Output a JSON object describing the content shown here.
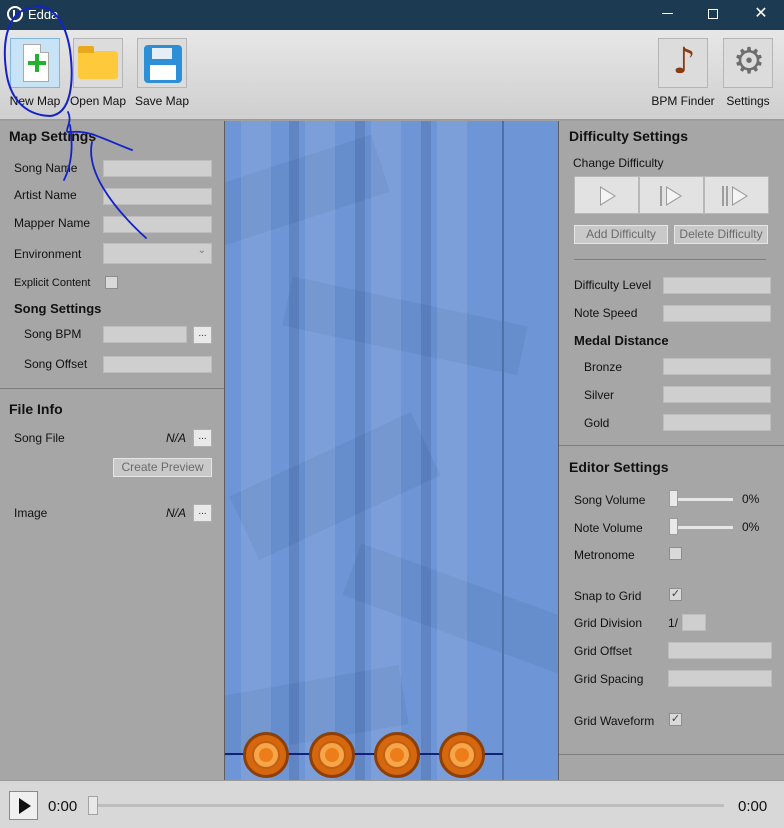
{
  "window": {
    "title": "Edda",
    "minimize_label": "—",
    "maximize_label": "☐",
    "close_label": "✕"
  },
  "toolbar": {
    "new_map": "New Map",
    "open_map": "Open Map",
    "save_map": "Save Map",
    "bpm_finder": "BPM Finder",
    "settings": "Settings",
    "note_glyph": "♪",
    "gear_glyph": "⚙"
  },
  "map_settings": {
    "title": "Map Settings",
    "song_name": "Song Name",
    "artist_name": "Artist Name",
    "mapper_name": "Mapper Name",
    "environment": "Environment",
    "explicit_content": "Explicit Content",
    "song_settings_title": "Song Settings",
    "song_bpm": "Song BPM",
    "song_offset": "Song Offset",
    "ellipsis": "..."
  },
  "file_info": {
    "title": "File Info",
    "song_file": "Song File",
    "song_file_value": "N/A",
    "create_preview": "Create Preview",
    "image": "Image",
    "image_value": "N/A",
    "ellipsis": "..."
  },
  "difficulty_settings": {
    "title": "Difficulty Settings",
    "change_difficulty": "Change Difficulty",
    "add_difficulty": "Add Difficulty",
    "delete_difficulty": "Delete Difficulty",
    "difficulty_level": "Difficulty Level",
    "note_speed": "Note Speed",
    "medal_distance": "Medal Distance",
    "bronze": "Bronze",
    "silver": "Silver",
    "gold": "Gold"
  },
  "editor_settings": {
    "title": "Editor Settings",
    "song_volume": "Song Volume",
    "song_volume_value": "0%",
    "note_volume": "Note Volume",
    "note_volume_value": "0%",
    "metronome": "Metronome",
    "snap_to_grid": "Snap to Grid",
    "grid_division": "Grid Division",
    "grid_division_prefix": "1/",
    "grid_offset": "Grid Offset",
    "grid_spacing": "Grid Spacing",
    "grid_waveform": "Grid Waveform",
    "check_mark": "✓"
  },
  "playback": {
    "current_time": "0:00",
    "total_time": "0:00"
  },
  "colors": {
    "titlebar": "#1c3a52",
    "editor_bg": "#6e95d5",
    "note_orange": "#d5670e",
    "annotation_blue": "#1423c8"
  }
}
